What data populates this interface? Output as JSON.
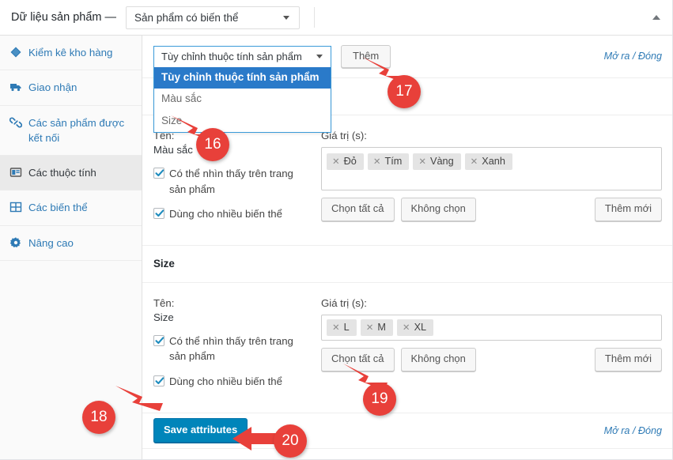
{
  "header": {
    "title": "Dữ liệu sản phẩm —",
    "product_type": "Sản phẩm có biến thể",
    "collapse_icon": "triangle-up-icon"
  },
  "sidebar": {
    "items": [
      {
        "label": "Kiểm kê kho hàng",
        "icon": "inventory-icon",
        "active": false
      },
      {
        "label": "Giao nhận",
        "icon": "truck-icon",
        "active": false
      },
      {
        "label": "Các sản phẩm được kết nối",
        "icon": "link-icon",
        "active": false
      },
      {
        "label": "Các thuộc tính",
        "icon": "attributes-window-icon",
        "active": true
      },
      {
        "label": "Các biến thể",
        "icon": "grid-icon",
        "active": false
      },
      {
        "label": "Nâng cao",
        "icon": "gear-icon",
        "active": false
      }
    ]
  },
  "toolbar": {
    "select_value": "Tùy chỉnh thuộc tính sản phẩm",
    "add_button": "Thêm",
    "toggle_link": "Mở ra / Đóng",
    "dropdown_options": [
      {
        "label": "Tùy chỉnh thuộc tính sản phẩm",
        "selected": true
      },
      {
        "label": "Màu sắc",
        "selected": false
      },
      {
        "label": "Size",
        "selected": false
      }
    ]
  },
  "labels": {
    "name": "Tên:",
    "values": "Giá trị (s):",
    "visible": "Có thể nhìn thấy trên trang sản phẩm",
    "variation": "Dùng cho nhiều biến thể",
    "select_all": "Chọn tất cả",
    "select_none": "Không chọn",
    "add_new": "Thêm mới"
  },
  "attributes": [
    {
      "heading": "Màu sắc",
      "name": "Màu sắc",
      "visible_checked": true,
      "variation_checked": true,
      "values": [
        "Đỏ",
        "Tím",
        "Vàng",
        "Xanh"
      ]
    },
    {
      "heading": "Size",
      "name": "Size",
      "visible_checked": true,
      "variation_checked": true,
      "values": [
        "L",
        "M",
        "XL"
      ]
    }
  ],
  "footer": {
    "save_button": "Save attributes",
    "toggle_link": "Mở ra / Đóng"
  },
  "annotations": [
    {
      "number": "16",
      "target": "dropdown-option-size"
    },
    {
      "number": "17",
      "target": "add-attribute-button"
    },
    {
      "number": "18",
      "target": "size-variation-checkbox"
    },
    {
      "number": "19",
      "target": "size-select-all-button"
    },
    {
      "number": "20",
      "target": "save-attributes-button"
    }
  ],
  "colors": {
    "accent": "#0085ba",
    "annotation": "#e8403a",
    "link": "#2e7ab5",
    "dropdown_selected": "#2a7ac9"
  }
}
